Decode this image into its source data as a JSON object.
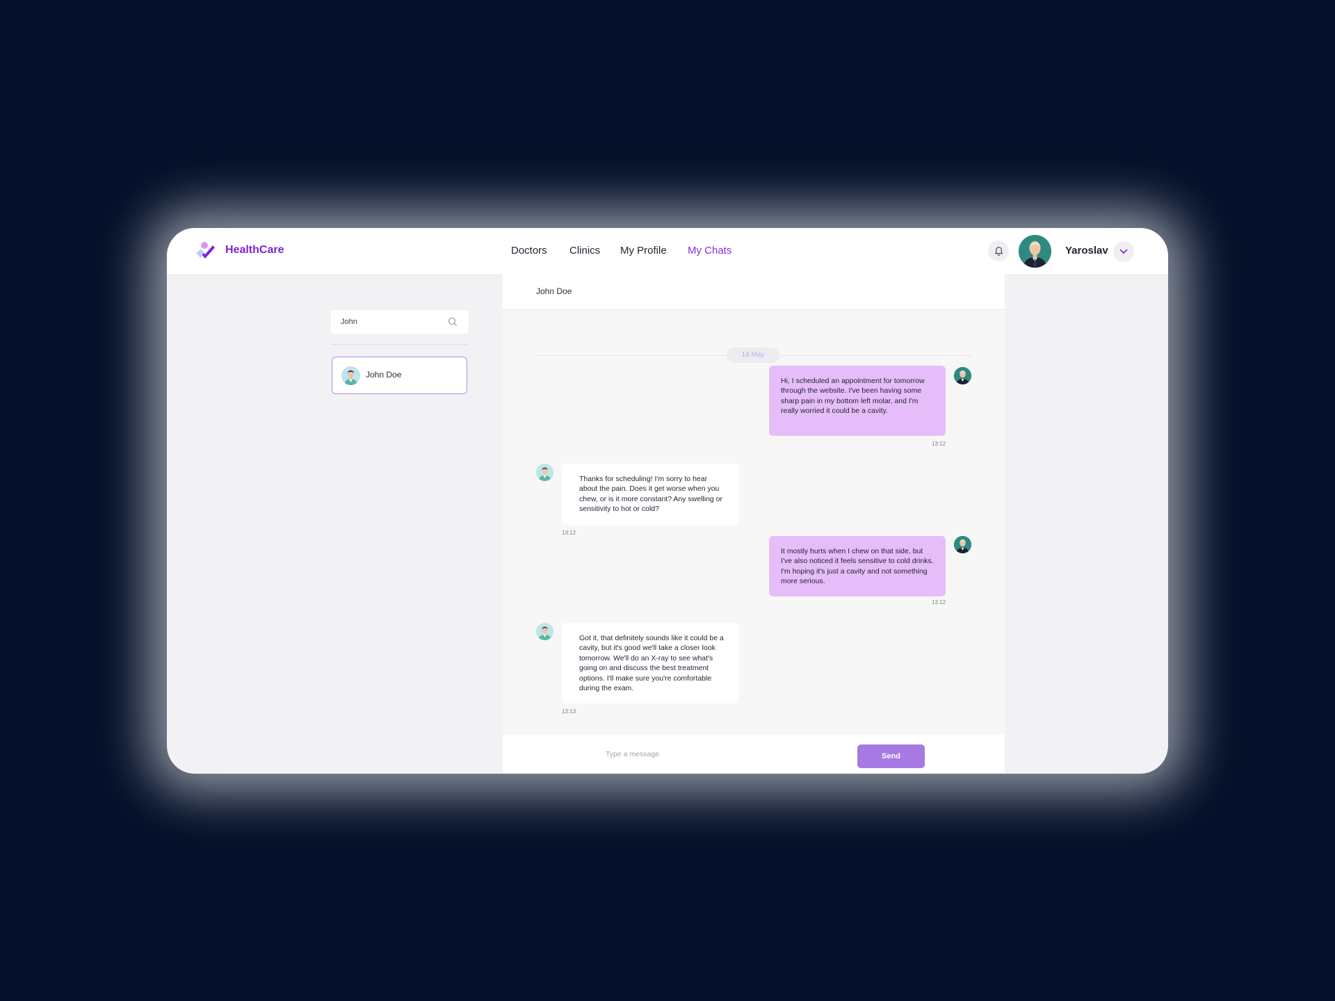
{
  "app": {
    "brand": "HealthCare",
    "accent_color": "#8a2be2",
    "logo_icon": "healthcare-logo-icon"
  },
  "nav": {
    "items": [
      {
        "label": "Doctors",
        "active": false
      },
      {
        "label": "Clinics",
        "active": false
      },
      {
        "label": "My Profile",
        "active": false
      },
      {
        "label": "My Chats",
        "active": true
      }
    ]
  },
  "user": {
    "name": "Yaroslav",
    "avatar_icon": "user-avatar",
    "notification_icon": "bell-icon",
    "menu_icon": "chevron-down-icon"
  },
  "sidebar": {
    "search": {
      "value": "John",
      "icon": "search-icon"
    },
    "contacts": [
      {
        "name": "John Doe",
        "selected": true
      }
    ]
  },
  "chat": {
    "title": "John Doe",
    "date_label": "14 May",
    "messages": [
      {
        "from": "me",
        "text": "Hi, I scheduled an appointment for tomorrow through the website. I've been having some sharp pain in my bottom left molar, and I'm really worried it could be a cavity.",
        "time": "13:12"
      },
      {
        "from": "them",
        "text": "Thanks for scheduling! I'm sorry to hear about the pain. Does it get worse when you chew, or is it more constant? Any swelling or sensitivity to hot or cold?",
        "time": "13:12"
      },
      {
        "from": "me",
        "text": "It mostly hurts when I chew on that side, but I've also noticed it feels sensitive to cold drinks. I'm hoping it's just a cavity and not something more serious.",
        "time": "13:12"
      },
      {
        "from": "them",
        "text": "Got it, that definitely sounds like it could be a cavity, but it's good we'll take a closer look tomorrow. We'll do an X-ray to see what's going on and discuss the best treatment options. I'll make sure you're comfortable during the exam.",
        "time": "13:13"
      }
    ],
    "composer": {
      "placeholder": "Type a message",
      "send_label": "Send"
    }
  },
  "colors": {
    "background": "#05112a",
    "outgoing_bubble": "#e6bdf8",
    "incoming_bubble": "#ffffff",
    "send_button": "#a779e3"
  }
}
